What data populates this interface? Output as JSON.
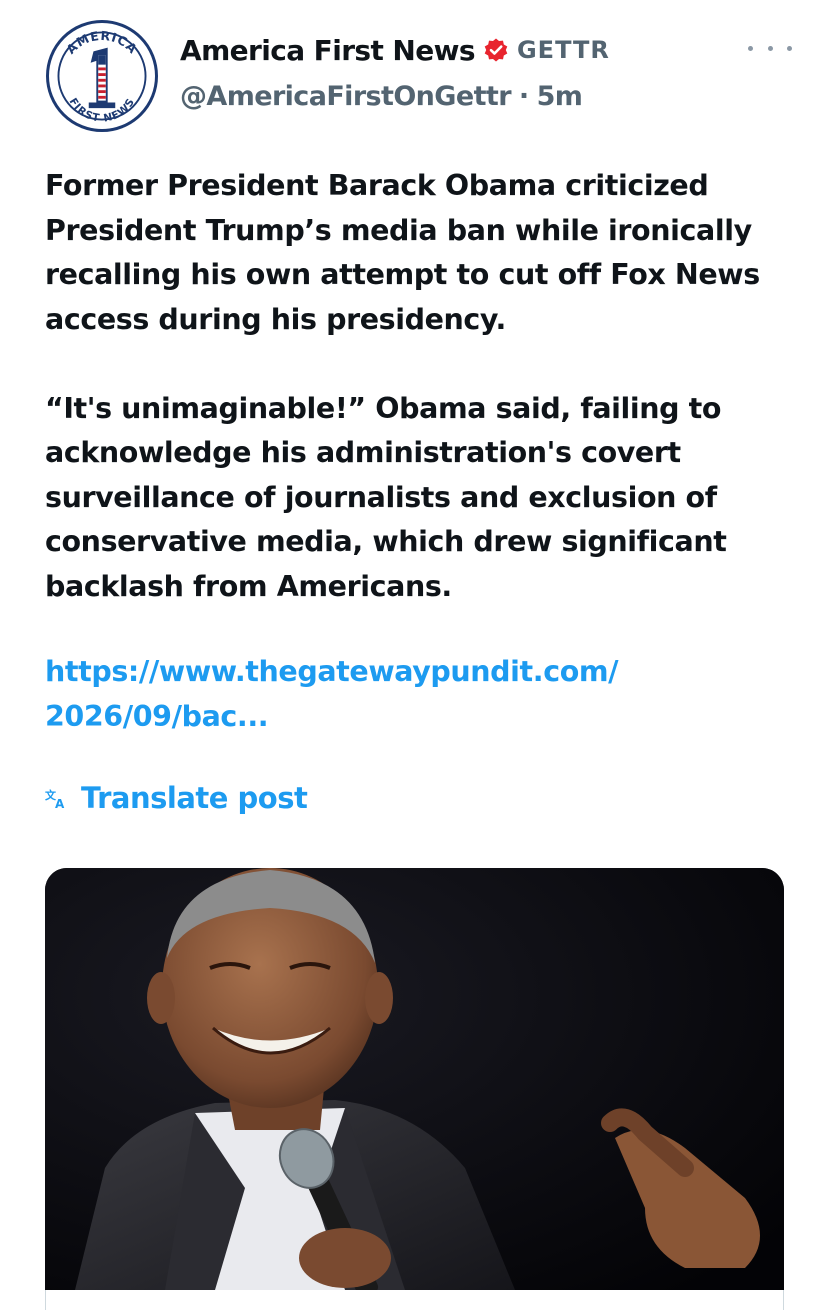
{
  "author": {
    "display_name": "America First News",
    "platform": "GETTR",
    "handle": "@AmericaFirstOnGettr",
    "separator": "·",
    "time_ago": "5m",
    "avatar_icon": "america-first-news-logo",
    "avatar_text_top": "AMERICA",
    "avatar_text_bottom": "FIRST NEWS",
    "avatar_numeral": "1",
    "verified_icon": "verified-badge-icon",
    "verified_color": "#e8242e"
  },
  "post": {
    "paragraphs": [
      "Former President Barack Obama criticized President Trump’s media ban while ironically recalling his own attempt to cut off Fox News access during his presidency.",
      "“It's unimaginable!” Obama said, failing to acknowledge his administration's covert surveillance of journalists and exclusion of conservative media, which drew significant backlash from Americans."
    ],
    "link_lines": [
      "https://www.thegatewaypundit.com/",
      "2026/09/bac..."
    ],
    "translate_label": "Translate post",
    "translate_icon": "translate-icon"
  },
  "media": {
    "description_icon": "photo-of-smiling-man-holding-microphone"
  },
  "colors": {
    "text": "#0f1419",
    "secondary": "#536471",
    "link": "#1d9bf0",
    "background": "#ffffff"
  }
}
